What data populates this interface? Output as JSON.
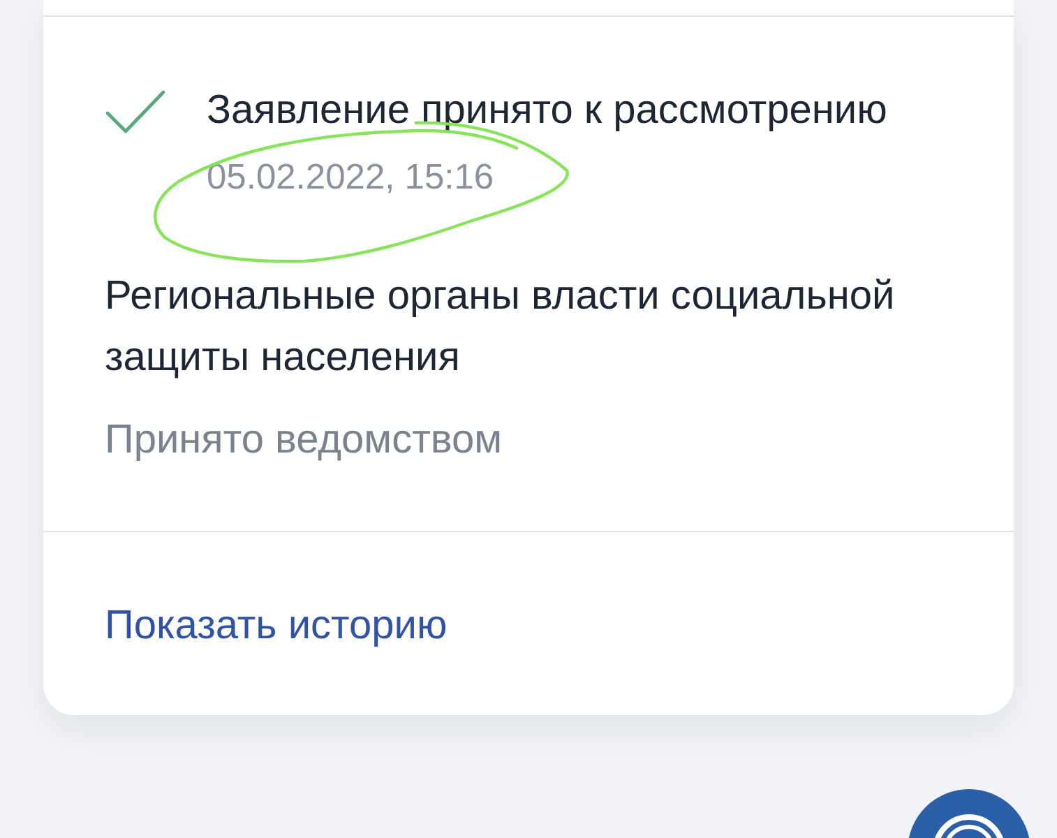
{
  "card": {
    "status": {
      "title": "Заявление принято к рассмотрению",
      "date": "05.02.2022, 15:16",
      "done": true
    },
    "department": "Региональные органы власти социальной защиты населения",
    "department_status": "Принято ведомством",
    "history_link": "Показать историю"
  }
}
